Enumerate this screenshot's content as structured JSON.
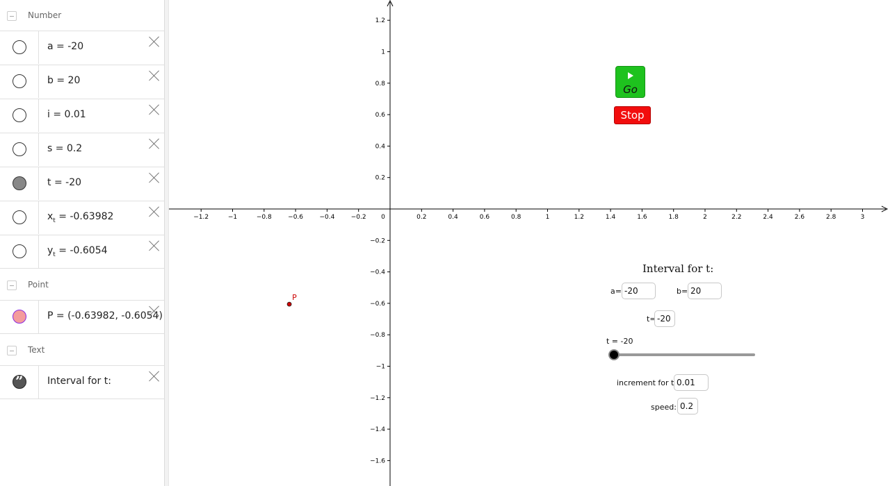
{
  "algebra": {
    "groups": {
      "number": "Number",
      "point": "Point",
      "text": "Text"
    },
    "rows": [
      {
        "name": "a",
        "value": "-20",
        "style": "empty"
      },
      {
        "name": "b",
        "value": "20",
        "style": "empty"
      },
      {
        "name": "i",
        "value": "0.01",
        "style": "empty"
      },
      {
        "name": "s",
        "value": "0.2",
        "style": "empty"
      },
      {
        "name": "t",
        "value": "-20",
        "style": "filled"
      },
      {
        "name": "x",
        "sub": "t",
        "value": "-0.63982",
        "style": "empty"
      },
      {
        "name": "y",
        "sub": "t",
        "value": "-0.6054",
        "style": "empty"
      },
      {
        "name": "P",
        "value": "(-0.63982, -0.6054)",
        "style": "point"
      },
      {
        "name": "",
        "value": "Interval for t:",
        "style": "text"
      }
    ],
    "eq": " = "
  },
  "graphics": {
    "x_ticks": [
      "-1.2",
      "-1",
      "-0.8",
      "-0.6",
      "-0.4",
      "-0.2",
      "0.2",
      "0.4",
      "0.6",
      "0.8",
      "1",
      "1.2",
      "1.4",
      "1.6",
      "1.8",
      "2",
      "2.2",
      "2.4",
      "2.6",
      "2.8",
      "3"
    ],
    "x_tick_values": [
      -1.2,
      -1,
      -0.8,
      -0.6,
      -0.4,
      -0.2,
      0.2,
      0.4,
      0.6,
      0.8,
      1,
      1.2,
      1.4,
      1.6,
      1.8,
      2,
      2.2,
      2.4,
      2.6,
      2.8,
      3
    ],
    "y_ticks": [
      "1.2",
      "1",
      "0.8",
      "0.6",
      "0.4",
      "0.2",
      "-0.2",
      "-0.4",
      "-0.6",
      "-0.8",
      "-1",
      "-1.2",
      "-1.4",
      "-1.6"
    ],
    "y_tick_values": [
      1.2,
      1,
      0.8,
      0.6,
      0.4,
      0.2,
      -0.2,
      -0.4,
      -0.6,
      -0.8,
      -1,
      -1.2,
      -1.4,
      -1.6
    ],
    "origin_label": "0",
    "point": {
      "label": "P",
      "x": -0.63982,
      "y": -0.6054,
      "color": "#cc0000"
    },
    "go_label": "Go",
    "stop_label": "Stop",
    "interval_title": "Interval for t:",
    "a_label": "a=",
    "a_value": "-20",
    "b_label": "b=",
    "b_value": "20",
    "t_label": "t=",
    "t_value": "-20",
    "slider_label": "t = -20",
    "slider_fraction": 0,
    "increment_label": "increment for t:",
    "increment_value": "0.01",
    "speed_label": "speed:",
    "speed_value": "0.2",
    "colors": {
      "go": "#1ec21e",
      "stop": "#f20d0d",
      "point": "#cc0000"
    }
  }
}
